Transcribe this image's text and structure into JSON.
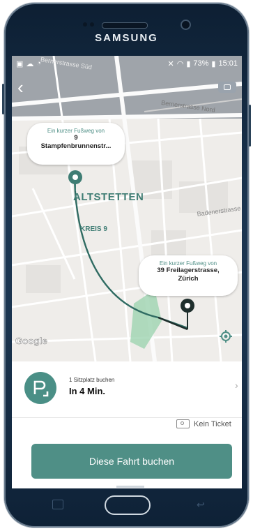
{
  "device": {
    "brand": "SAMSUNG"
  },
  "status_bar": {
    "time": "15:01",
    "battery": "73%"
  },
  "map": {
    "streets": [
      "Bernerstrasse Süd",
      "Bernerstrasse Nord",
      "Badenerstrasse"
    ],
    "district": "ALTSTETTEN",
    "kreis": "KREIS 9",
    "attribution": "Google"
  },
  "pickup": {
    "note": "Ein kurzer Fußweg von",
    "number": "9",
    "street": "Stampfenbrunnenstr..."
  },
  "dropoff": {
    "note": "Ein kurzer Fußweg von",
    "address_line1": "39 Freilagerstrasse,",
    "address_line2": "Zürich"
  },
  "ride": {
    "seat_label": "1 Sitzplatz buchen",
    "eta": "In 4 Min.",
    "ticket_label": "Kein Ticket",
    "book_button": "Diese Fahrt buchen"
  },
  "colors": {
    "accent": "#4f8f86",
    "route": "#2f6b62",
    "dark_route": "#1e2e2c"
  }
}
